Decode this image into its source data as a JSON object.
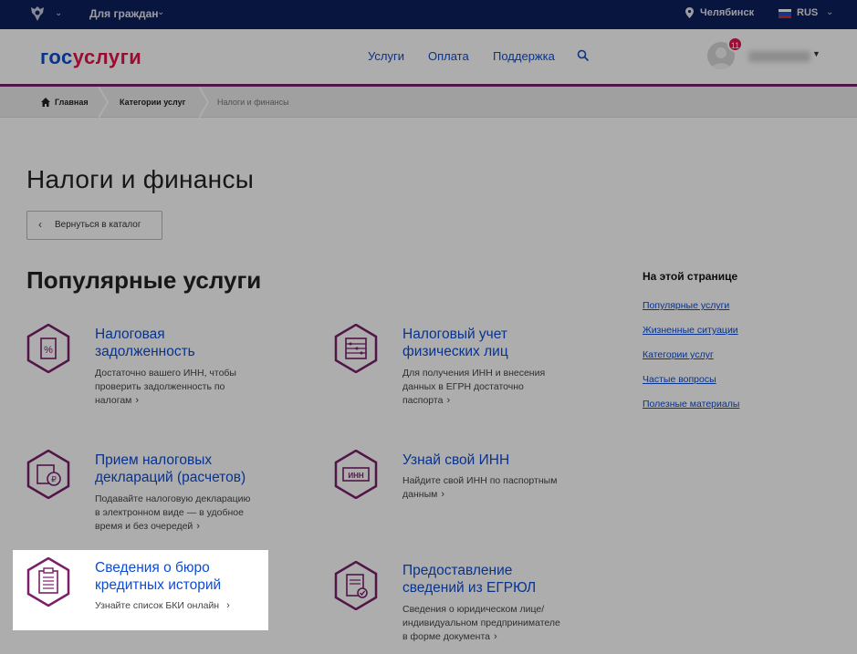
{
  "topbar": {
    "audience_label": "Для граждан",
    "city": "Челябинск",
    "language": "RUS"
  },
  "header": {
    "logo_part1": "гос",
    "logo_part2": "услуги",
    "nav": [
      "Услуги",
      "Оплата",
      "Поддержка"
    ],
    "notifications_count": "11"
  },
  "breadcrumb": {
    "items": [
      "Главная",
      "Категории услуг",
      "Налоги и финансы"
    ]
  },
  "main": {
    "page_title": "Налоги и финансы",
    "back_label": "Вернуться в каталог",
    "section_title": "Популярные услуги",
    "services": [
      {
        "title_line1": "Налоговая",
        "title_line2": "задолженность",
        "desc_lines": [
          "Достаточно вашего ИНН, чтобы",
          "проверить задолженность по",
          "налогам"
        ],
        "icon": "percent-doc-icon"
      },
      {
        "title_line1": "Налоговый учет",
        "title_line2": "физических лиц",
        "desc_lines": [
          "Для получения ИНН и внесения",
          "данных в ЕГРН достаточно",
          "паспорта"
        ],
        "icon": "abacus-icon"
      },
      {
        "title_line1": "Прием налоговых",
        "title_line2": "деклараций (расчетов)",
        "desc_lines": [
          "Подавайте налоговую декларацию",
          "в электронном виде — в удобное",
          "время и без очередей"
        ],
        "icon": "ruble-declaration-icon"
      },
      {
        "title_line1": "Узнай свой ИНН",
        "title_line2": "",
        "desc_lines": [
          "Найдите свой ИНН по паспортным",
          "данным"
        ],
        "icon": "inn-card-icon"
      },
      {
        "title_line1": "Сведения о бюро",
        "title_line2": "кредитных историй",
        "desc_lines": [
          "Узнайте список БКИ онлайн"
        ],
        "icon": "clipboard-list-icon"
      },
      {
        "title_line1": "Предоставление",
        "title_line2": "сведений из ЕГРЮЛ",
        "desc_lines": [
          "Сведения о юридическом лице/",
          "индивидуальном предпринимателе",
          "в форме документа"
        ],
        "icon": "document-check-icon"
      }
    ]
  },
  "toc": {
    "title": "На этой странице",
    "links": [
      "Популярные услуги",
      "Жизненные ситуации",
      "Категории услуг",
      "Частые вопросы",
      "Полезные материалы"
    ]
  },
  "colors": {
    "topbar": "#0d1f5c",
    "link": "#0d4cd3",
    "brand_red": "#e3124b",
    "icon_purple": "#7a1f6a"
  }
}
